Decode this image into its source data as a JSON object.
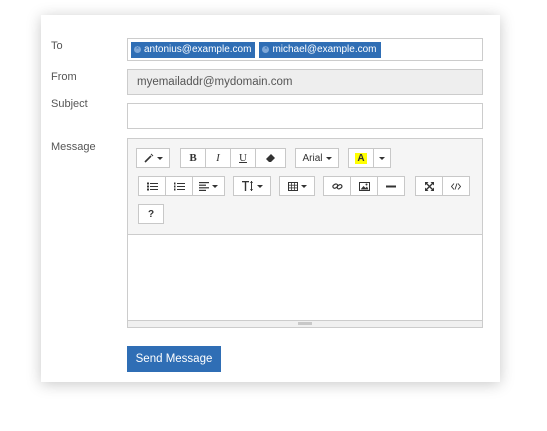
{
  "form": {
    "to_label": "To",
    "recipients": [
      "antonius@example.com",
      "michael@example.com"
    ],
    "from_label": "From",
    "from_value": "myemailaddr@mydomain.com",
    "subject_label": "Subject",
    "subject_value": "",
    "message_label": "Message",
    "send_label": "Send Message"
  },
  "toolbar": {
    "bold": "B",
    "italic": "I",
    "underline": "U",
    "font_name": "Arial",
    "color_letter": "A",
    "help": "?"
  },
  "colors": {
    "accent": "#2f6eb5",
    "highlight": "#ffff00"
  },
  "icons": [
    "magic-icon",
    "eraser-icon",
    "unordered-list-icon",
    "ordered-list-icon",
    "align-icon",
    "line-height-icon",
    "table-icon",
    "link-icon",
    "picture-icon",
    "horizontal-rule-icon",
    "fullscreen-icon",
    "code-view-icon"
  ]
}
